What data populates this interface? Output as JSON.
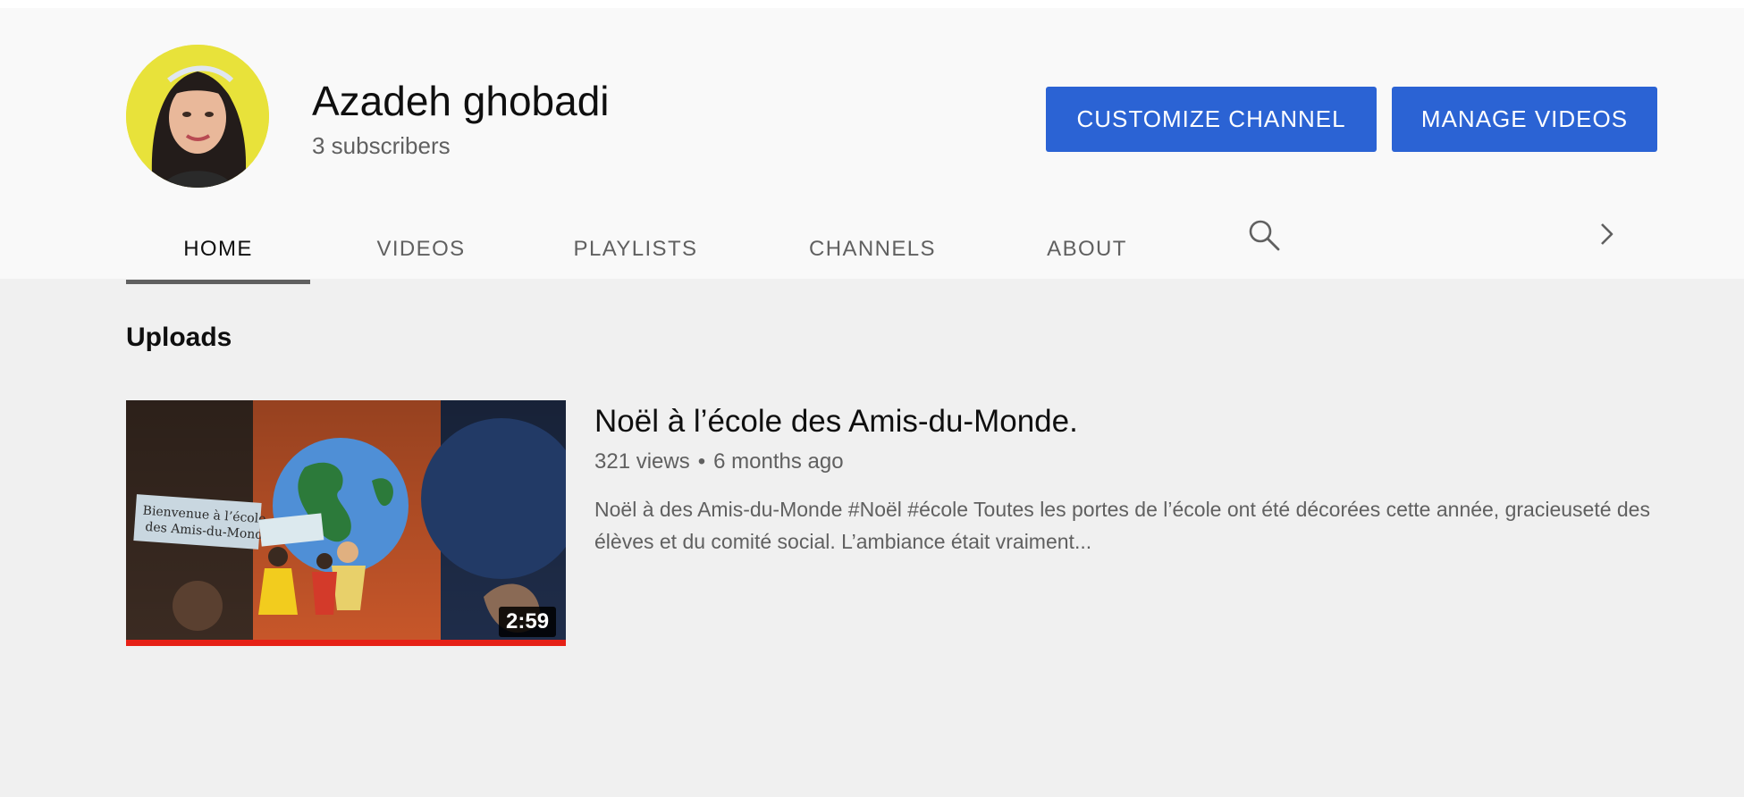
{
  "channel": {
    "name": "Azadeh ghobadi",
    "subscribers": "3 subscribers"
  },
  "actions": {
    "customize_label": "CUSTOMIZE CHANNEL",
    "manage_label": "MANAGE VIDEOS"
  },
  "tabs": [
    {
      "label": "HOME",
      "active": true
    },
    {
      "label": "VIDEOS",
      "active": false
    },
    {
      "label": "PLAYLISTS",
      "active": false
    },
    {
      "label": "CHANNELS",
      "active": false
    },
    {
      "label": "ABOUT",
      "active": false
    }
  ],
  "icons": {
    "search": "search-icon",
    "next": "chevron-right-icon"
  },
  "uploads": {
    "title": "Uploads",
    "videos": [
      {
        "title": "Noël à l’école des Amis-du-Monde.",
        "views": "321 views",
        "separator": "•",
        "age": "6 months ago",
        "duration": "2:59",
        "watched_fraction": 1.0,
        "description": "Noël à des Amis-du-Monde #Noël #école Toutes les portes de l’école ont été décorées cette année, gracieuseté des élèves et du comité social. L’ambiance était vraiment..."
      }
    ]
  },
  "colors": {
    "accent_button": "#2b63d4",
    "progress": "#e62117",
    "header_bg": "#f9f9f9",
    "page_bg": "#f0f0f0"
  }
}
